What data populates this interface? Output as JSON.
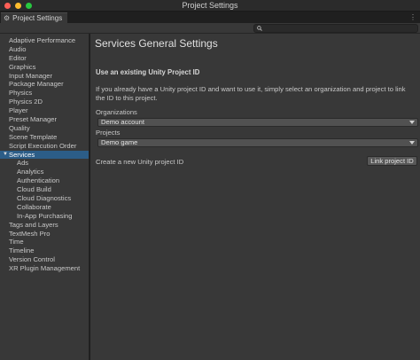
{
  "window": {
    "title": "Project Settings"
  },
  "tab": {
    "label": "Project Settings",
    "icon": "gear-icon",
    "menu_icon": "kebab-menu-icon"
  },
  "search": {
    "value": "",
    "placeholder": ""
  },
  "sidebar": {
    "items": [
      {
        "label": "Adaptive Performance",
        "sub": false
      },
      {
        "label": "Audio",
        "sub": false
      },
      {
        "label": "Editor",
        "sub": false
      },
      {
        "label": "Graphics",
        "sub": false
      },
      {
        "label": "Input Manager",
        "sub": false
      },
      {
        "label": "Package Manager",
        "sub": false
      },
      {
        "label": "Physics",
        "sub": false
      },
      {
        "label": "Physics 2D",
        "sub": false
      },
      {
        "label": "Player",
        "sub": false
      },
      {
        "label": "Preset Manager",
        "sub": false
      },
      {
        "label": "Quality",
        "sub": false
      },
      {
        "label": "Scene Template",
        "sub": false
      },
      {
        "label": "Script Execution Order",
        "sub": false
      },
      {
        "label": "Services",
        "sub": false,
        "selected": true,
        "expanded": true
      },
      {
        "label": "Ads",
        "sub": true
      },
      {
        "label": "Analytics",
        "sub": true
      },
      {
        "label": "Authentication",
        "sub": true
      },
      {
        "label": "Cloud Build",
        "sub": true
      },
      {
        "label": "Cloud Diagnostics",
        "sub": true
      },
      {
        "label": "Collaborate",
        "sub": true
      },
      {
        "label": "In-App Purchasing",
        "sub": true
      },
      {
        "label": "Tags and Layers",
        "sub": false
      },
      {
        "label": "TextMesh Pro",
        "sub": false
      },
      {
        "label": "Time",
        "sub": false
      },
      {
        "label": "Timeline",
        "sub": false
      },
      {
        "label": "Version Control",
        "sub": false
      },
      {
        "label": "XR Plugin Management",
        "sub": false
      }
    ]
  },
  "main": {
    "title": "Services General Settings",
    "section_heading": "Use an existing Unity Project ID",
    "description": "If you already have a Unity project ID and want to use it, simply select an organization and project to link the ID to this project.",
    "organizations_label": "Organizations",
    "organizations_value": "Demo account",
    "projects_label": "Projects",
    "projects_value": "Demo game",
    "create_label": "Create a new Unity project ID",
    "link_button": "Link project ID"
  },
  "colors": {
    "selected": "#2c5d87",
    "panel": "#383838",
    "background": "#1e1e1e"
  }
}
